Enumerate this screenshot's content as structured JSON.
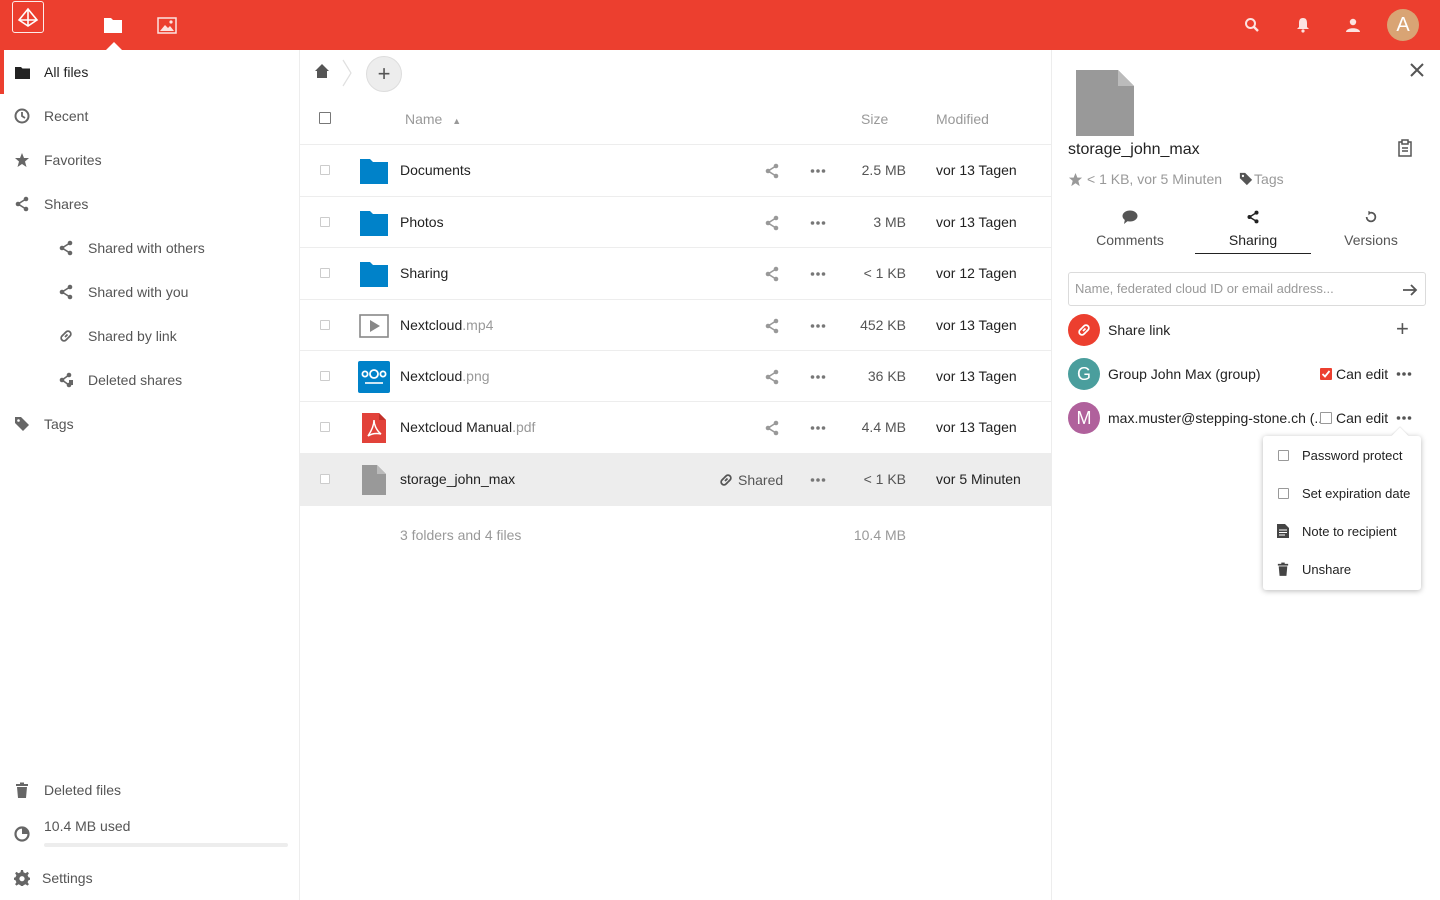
{
  "header": {
    "apps": [
      "files-icon",
      "gallery-icon"
    ],
    "right_icons": [
      "search-icon",
      "notifications-icon",
      "contacts-icon"
    ],
    "avatar_letter": "A",
    "accent": "#ec3f2f"
  },
  "sidebar": {
    "items": [
      {
        "label": "All files",
        "icon": "folder-icon",
        "active": true
      },
      {
        "label": "Recent",
        "icon": "clock-icon"
      },
      {
        "label": "Favorites",
        "icon": "star-icon"
      },
      {
        "label": "Shares",
        "icon": "share-icon"
      },
      {
        "label": "Shared with others",
        "icon": "share-icon"
      },
      {
        "label": "Shared with you",
        "icon": "share-icon"
      },
      {
        "label": "Shared by link",
        "icon": "link-icon"
      },
      {
        "label": "Deleted shares",
        "icon": "deleted-share-icon"
      },
      {
        "label": "Tags",
        "icon": "tag-icon"
      }
    ],
    "deleted_files": "Deleted files",
    "quota": "10.4 MB used",
    "quota_fraction": 0.0,
    "settings": "Settings"
  },
  "files": {
    "columns": {
      "name": "Name",
      "size": "Size",
      "modified": "Modified"
    },
    "rows": [
      {
        "base": "Documents",
        "ext": "",
        "type": "folder",
        "size": "2.5 MB",
        "modified": "vor 13 Tagen"
      },
      {
        "base": "Photos",
        "ext": "",
        "type": "folder",
        "size": "3 MB",
        "modified": "vor 13 Tagen"
      },
      {
        "base": "Sharing",
        "ext": "",
        "type": "folder",
        "size": "< 1 KB",
        "modified": "vor 12 Tagen"
      },
      {
        "base": "Nextcloud",
        "ext": ".mp4",
        "type": "video",
        "size": "452 KB",
        "modified": "vor 13 Tagen"
      },
      {
        "base": "Nextcloud",
        "ext": ".png",
        "type": "image",
        "size": "36 KB",
        "modified": "vor 13 Tagen"
      },
      {
        "base": "Nextcloud Manual",
        "ext": ".pdf",
        "type": "pdf",
        "size": "4.4 MB",
        "modified": "vor 13 Tagen"
      },
      {
        "base": "storage_john_max",
        "ext": "",
        "type": "file",
        "size": "< 1 KB",
        "modified": "vor 5 Minuten",
        "shared_label": "Shared"
      }
    ],
    "summary": "3 folders and 4 files",
    "summary_size": "10.4 MB"
  },
  "details": {
    "filename": "storage_john_max",
    "meta": "< 1 KB, vor 5 Minuten",
    "tags": "Tags",
    "tabs": [
      {
        "label": "Comments",
        "icon": "comment-icon"
      },
      {
        "label": "Sharing",
        "icon": "share-icon",
        "active": true
      },
      {
        "label": "Versions",
        "icon": "history-icon"
      }
    ],
    "share_placeholder": "Name, federated cloud ID or email address...",
    "share_link_label": "Share link",
    "shares": [
      {
        "avatar": "G",
        "name": "Group John Max (group)",
        "perm": "Can edit",
        "checked": true,
        "color": "#4a9e9d"
      },
      {
        "avatar": "M",
        "name": "max.muster@stepping-stone.ch (...",
        "perm": "Can edit",
        "checked": false,
        "color": "#b0619c"
      }
    ],
    "menu": [
      "Password protect",
      "Set expiration date",
      "Note to recipient",
      "Unshare"
    ]
  }
}
